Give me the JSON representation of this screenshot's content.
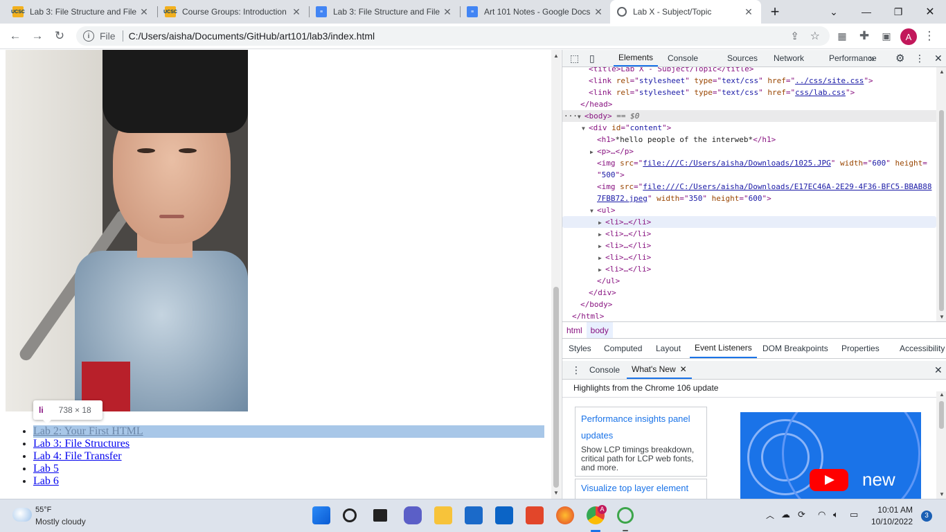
{
  "browser": {
    "tabs": [
      {
        "title": "Lab 3: File Structure and File",
        "favicon": "ucsc-icon"
      },
      {
        "title": "Course Groups: Introduction",
        "favicon": "ucsc-icon"
      },
      {
        "title": "Lab 3: File Structure and File",
        "favicon": "docs-icon"
      },
      {
        "title": "Art 101 Notes - Google Docs",
        "favicon": "docs-icon"
      },
      {
        "title": "Lab X - Subject/Topic",
        "favicon": "globe-icon",
        "active": true
      }
    ],
    "address": {
      "scheme": "File",
      "url": "C:/Users/aisha/Documents/GitHub/art101/lab3/index.html"
    },
    "profile_initial": "A"
  },
  "page": {
    "tooltip": {
      "tag": "li",
      "dimensions": "738 × 18"
    },
    "links": [
      "Lab 2: Your First HTML",
      "Lab 3: File Structures",
      "Lab 4: File Transfer",
      "Lab 5",
      "Lab 6"
    ]
  },
  "devtools": {
    "tabs": [
      "Elements",
      "Console",
      "Sources",
      "Network",
      "Performance"
    ],
    "more_tabs": "»",
    "dom": {
      "title_line": "<title>Lab X - Subject/Topic</title>",
      "link1_href": "../css/site.css",
      "link2_href": "css/lab.css",
      "head_close": "</head>",
      "body_marker": "== $0",
      "div_id": "content",
      "h1_text": "*hello people of the interweb*",
      "p_collapsed": "<p>…</p>",
      "img1_src": "file:///C:/Users/aisha/Downloads/1025.JPG",
      "img1_width": "600",
      "img1_height": "500",
      "img2_src_a": "file:///C:/Users/aisha/Downloads/E17EC46A-2E29-4F36-BFC5-BBAB88",
      "img2_src_b": "7FBB72.jpeg",
      "img2_width": "350",
      "img2_height": "600",
      "li_collapsed": "<li>…</li>",
      "ul_close": "</ul>",
      "div_close": "</div>",
      "body_close": "</body>",
      "html_close": "</html>"
    },
    "breadcrumbs": [
      "html",
      "body"
    ],
    "panel_tabs": [
      "Styles",
      "Computed",
      "Layout",
      "Event Listeners",
      "DOM Breakpoints",
      "Properties",
      "Accessibility"
    ],
    "panel_active": "Event Listeners",
    "drawer": {
      "tabs": [
        "Console",
        "What's New"
      ],
      "active": "What's New",
      "headline": "Highlights from the Chrome 106 update",
      "cards": [
        {
          "title": "Performance insights panel updates",
          "body": "Show LCP timings breakdown, critical path for LCP web fonts, and more."
        },
        {
          "title": "Visualize top layer element",
          "body": ""
        }
      ],
      "promo_text": "new"
    }
  },
  "taskbar": {
    "weather": {
      "temp": "55°F",
      "desc": "Mostly cloudy"
    },
    "time": "10:01 AM",
    "date": "10/10/2022",
    "notification_count": "3"
  },
  "colors": {
    "accent": "#1a73e8",
    "tab_bg": "#dee1e6",
    "taskbar": "#dde3ec"
  }
}
